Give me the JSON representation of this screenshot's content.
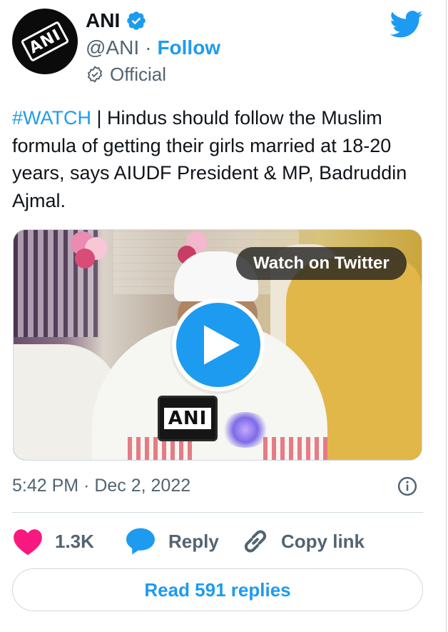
{
  "author": {
    "name": "ANI",
    "handle": "@ANI",
    "separator": "·",
    "follow_label": "Follow",
    "affiliation_label": "Official",
    "avatar_logo_text": "ANI"
  },
  "tweet": {
    "hashtag": "#WATCH",
    "body": " | Hindus should follow the Muslim formula of getting their girls married at 18-20 years, says AIUDF President & MP, Badruddin Ajmal."
  },
  "media": {
    "watch_label": "Watch on Twitter",
    "mic_label": "ANI"
  },
  "meta": {
    "time": "5:42 PM",
    "separator": " · ",
    "date": "Dec 2, 2022"
  },
  "actions": {
    "like_count": "1.3K",
    "reply_label": "Reply",
    "copy_link_label": "Copy link",
    "read_replies_label": "Read 591 replies"
  },
  "colors": {
    "accent": "#1d9bf0",
    "like": "#f91880",
    "secondary_text": "#536471"
  },
  "icons": [
    "twitter-bird-icon",
    "verified-badge-icon",
    "official-badge-icon",
    "play-icon",
    "info-icon",
    "heart-icon",
    "reply-bubble-icon",
    "link-icon"
  ]
}
